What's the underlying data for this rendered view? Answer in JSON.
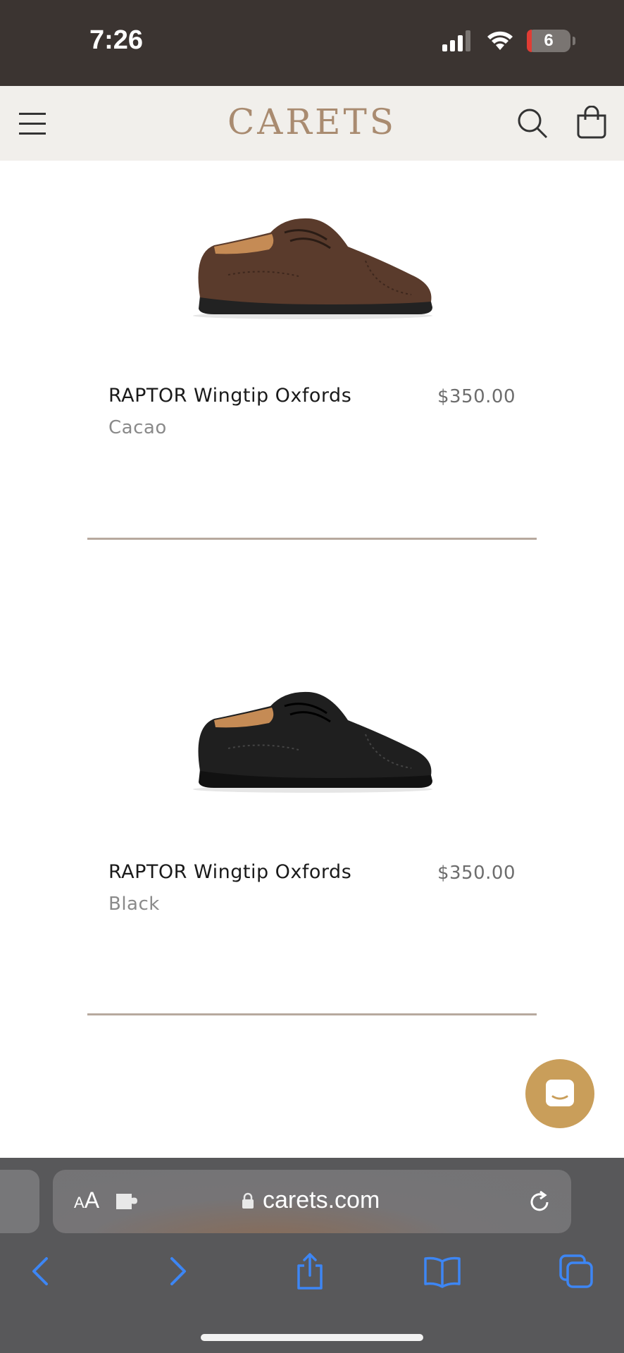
{
  "status_bar": {
    "time": "7:26",
    "battery_level": "6"
  },
  "header": {
    "brand": "CARETS"
  },
  "products": [
    {
      "title": "RAPTOR Wingtip Oxfords",
      "price": "$350.00",
      "variant": "Cacao",
      "color": "#5a3b2c"
    },
    {
      "title": "RAPTOR Wingtip Oxfords",
      "price": "$350.00",
      "variant": "Black",
      "color": "#1f1f1f"
    }
  ],
  "browser": {
    "aa_label_small": "A",
    "aa_label_large": "A",
    "url": "carets.com"
  },
  "colors": {
    "brand": "#a98b70",
    "chat_button": "#c99e5a",
    "safari_blue": "#3d86f4"
  },
  "icons": [
    "menu-icon",
    "search-icon",
    "cart-icon",
    "chat-icon",
    "lock-icon",
    "puzzle-icon",
    "reload-icon",
    "back-icon",
    "forward-icon",
    "share-icon",
    "bookmarks-icon",
    "tabs-icon"
  ]
}
